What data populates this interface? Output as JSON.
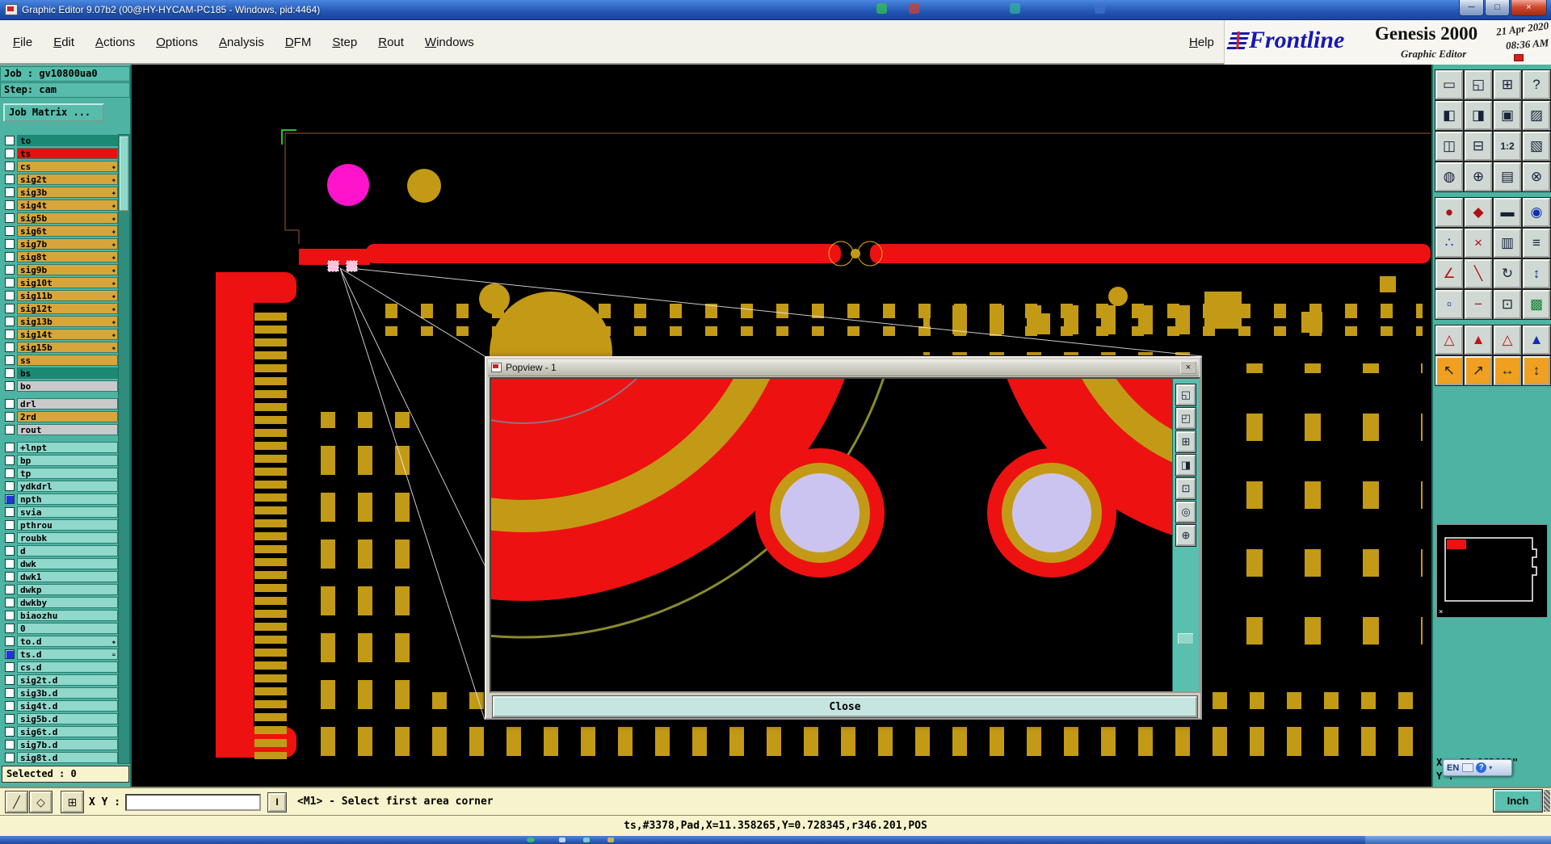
{
  "window": {
    "title": "Graphic Editor 9.07b2 (00@HY-HYCAM-PC185 - Windows, pid:4464)",
    "min_icon": "─",
    "max_icon": "□",
    "close_icon": "×"
  },
  "menubar": {
    "items": [
      "File",
      "Edit",
      "Actions",
      "Options",
      "Analysis",
      "DFM",
      "Step",
      "Rout",
      "Windows"
    ],
    "help": "Help"
  },
  "brand": {
    "logo": "Frontline",
    "product": "Genesis 2000",
    "subtitle": "Graphic Editor",
    "date": "21 Apr 2020",
    "time": "08:36 AM"
  },
  "job": {
    "job_line": "Job : gv10800ua0",
    "step_line": "Step: cam",
    "matrix_button": "Job Matrix ..."
  },
  "layers": {
    "colors": {
      "tan": "#d7a63b",
      "pale": "#90d8cb",
      "gray": "#c9c9c9",
      "dark": "#1b8a74",
      "red": "#e41212",
      "check_blue": "#2233dd"
    },
    "rows": [
      {
        "name": "to",
        "color": "#1b8a74",
        "check": "#ffffff",
        "mark": ""
      },
      {
        "name": "ts",
        "color": "#e41212",
        "check": "#ffffff",
        "mark": ""
      },
      {
        "name": "cs",
        "color": "#d7a63b",
        "check": "#ffffff",
        "mark": "◆"
      },
      {
        "name": "sig2t",
        "color": "#d7a63b",
        "check": "#ffffff",
        "mark": "◆"
      },
      {
        "name": "sig3b",
        "color": "#d7a63b",
        "check": "#ffffff",
        "mark": "◆"
      },
      {
        "name": "sig4t",
        "color": "#d7a63b",
        "check": "#ffffff",
        "mark": "◆"
      },
      {
        "name": "sig5b",
        "color": "#d7a63b",
        "check": "#ffffff",
        "mark": "◆"
      },
      {
        "name": "sig6t",
        "color": "#d7a63b",
        "check": "#ffffff",
        "mark": "◆"
      },
      {
        "name": "sig7b",
        "color": "#d7a63b",
        "check": "#ffffff",
        "mark": "◆"
      },
      {
        "name": "sig8t",
        "color": "#d7a63b",
        "check": "#ffffff",
        "mark": "◆"
      },
      {
        "name": "sig9b",
        "color": "#d7a63b",
        "check": "#ffffff",
        "mark": "◆"
      },
      {
        "name": "sig10t",
        "color": "#d7a63b",
        "check": "#ffffff",
        "mark": "◆"
      },
      {
        "name": "sig11b",
        "color": "#d7a63b",
        "check": "#ffffff",
        "mark": "◆"
      },
      {
        "name": "sig12t",
        "color": "#d7a63b",
        "check": "#ffffff",
        "mark": "◆"
      },
      {
        "name": "sig13b",
        "color": "#d7a63b",
        "check": "#ffffff",
        "mark": "◆"
      },
      {
        "name": "sig14t",
        "color": "#d7a63b",
        "check": "#ffffff",
        "mark": "◆"
      },
      {
        "name": "sig15b",
        "color": "#d7a63b",
        "check": "#ffffff",
        "mark": "◆"
      },
      {
        "name": "ss",
        "color": "#d7a63b",
        "check": "#ffffff",
        "mark": ""
      },
      {
        "name": "bs",
        "color": "#1b8a74",
        "check": "#ffffff",
        "mark": ""
      },
      {
        "name": "bo",
        "color": "#c9c9c9",
        "check": "#ffffff",
        "mark": ""
      },
      {
        "gap": true
      },
      {
        "name": "drl",
        "color": "#c9c9c9",
        "check": "#ffffff",
        "mark": ""
      },
      {
        "name": "2rd",
        "color": "#d7a63b",
        "check": "#ffffff",
        "mark": ""
      },
      {
        "name": "rout",
        "color": "#c9c9c9",
        "check": "#ffffff",
        "mark": ""
      },
      {
        "gap": true
      },
      {
        "name": "+lnpt",
        "color": "#90d8cb",
        "check": "#ffffff",
        "mark": ""
      },
      {
        "name": "bp",
        "color": "#90d8cb",
        "check": "#ffffff",
        "mark": ""
      },
      {
        "name": "tp",
        "color": "#90d8cb",
        "check": "#ffffff",
        "mark": ""
      },
      {
        "name": "ydkdrl",
        "color": "#90d8cb",
        "check": "#ffffff",
        "mark": ""
      },
      {
        "name": "npth",
        "color": "#90d8cb",
        "check": "#2233dd",
        "mark": ""
      },
      {
        "name": "svia",
        "color": "#90d8cb",
        "check": "#ffffff",
        "mark": ""
      },
      {
        "name": "pthrou",
        "color": "#90d8cb",
        "check": "#ffffff",
        "mark": ""
      },
      {
        "name": "roubk",
        "color": "#90d8cb",
        "check": "#ffffff",
        "mark": ""
      },
      {
        "name": "d",
        "color": "#90d8cb",
        "check": "#ffffff",
        "mark": ""
      },
      {
        "name": "dwk",
        "color": "#90d8cb",
        "check": "#ffffff",
        "mark": ""
      },
      {
        "name": "dwk1",
        "color": "#90d8cb",
        "check": "#ffffff",
        "mark": ""
      },
      {
        "name": "dwkp",
        "color": "#90d8cb",
        "check": "#ffffff",
        "mark": ""
      },
      {
        "name": "dwkby",
        "color": "#90d8cb",
        "check": "#ffffff",
        "mark": ""
      },
      {
        "name": "biaozhu",
        "color": "#90d8cb",
        "check": "#ffffff",
        "mark": ""
      },
      {
        "name": "0",
        "color": "#90d8cb",
        "check": "#ffffff",
        "mark": ""
      },
      {
        "name": "to.d",
        "color": "#90d8cb",
        "check": "#ffffff",
        "mark": "◆"
      },
      {
        "name": "ts.d",
        "color": "#90d8cb",
        "check": "#2233dd",
        "mark": "="
      },
      {
        "name": "cs.d",
        "color": "#90d8cb",
        "check": "#ffffff",
        "mark": ""
      },
      {
        "name": "sig2t.d",
        "color": "#90d8cb",
        "check": "#ffffff",
        "mark": ""
      },
      {
        "name": "sig3b.d",
        "color": "#90d8cb",
        "check": "#ffffff",
        "mark": ""
      },
      {
        "name": "sig4t.d",
        "color": "#90d8cb",
        "check": "#ffffff",
        "mark": ""
      },
      {
        "name": "sig5b.d",
        "color": "#90d8cb",
        "check": "#ffffff",
        "mark": ""
      },
      {
        "name": "sig6t.d",
        "color": "#90d8cb",
        "check": "#ffffff",
        "mark": ""
      },
      {
        "name": "sig7b.d",
        "color": "#90d8cb",
        "check": "#ffffff",
        "mark": ""
      },
      {
        "name": "sig8t.d",
        "color": "#90d8cb",
        "check": "#ffffff",
        "mark": ""
      }
    ]
  },
  "selected": {
    "label": "Selected : 0"
  },
  "status": {
    "xy_label": "X Y :",
    "xy_value": "",
    "tools": [
      {
        "g": "╱",
        "n": "line-mode-button"
      },
      {
        "g": "◇",
        "n": "shape-mode-button"
      },
      {
        "g": "⊞",
        "n": "grid-toggle-button"
      }
    ],
    "separator": "I",
    "prompt": "<M1> - Select first area corner",
    "readout": "ts,#3378,Pad,X=11.358265,Y=0.728345,r346.201,POS"
  },
  "right": {
    "x_label": "X :",
    "x_value": "22.862602\"",
    "y_label": "Y :",
    "y_value": "",
    "unit_button": "Inch",
    "lang": "EN",
    "help_icon": "?"
  },
  "popview": {
    "title": "Popview - 1",
    "x_icon": "×",
    "close_label": "Close",
    "tools": [
      {
        "g": "◱",
        "n": "popview-zoom-window-button"
      },
      {
        "g": "◰",
        "n": "popview-zoom-prev-button"
      },
      {
        "g": "⊞",
        "n": "popview-zoom-in-button"
      },
      {
        "g": "◨",
        "n": "popview-pan-button"
      },
      {
        "g": "⊡",
        "n": "popview-center-button"
      },
      {
        "g": "◎",
        "n": "popview-home-button"
      },
      {
        "g": "⊕",
        "n": "popview-crosshair-button"
      }
    ]
  },
  "toolbar": {
    "buttons": [
      {
        "g": "▭",
        "n": "zoom-window-button"
      },
      {
        "g": "◱",
        "n": "zoom-prev-button"
      },
      {
        "g": "⊞",
        "n": "zoom-in-button"
      },
      {
        "g": "?",
        "n": "help-tool-button"
      },
      {
        "g": "◧"
      },
      {
        "g": "◨"
      },
      {
        "g": "▣"
      },
      {
        "g": "▨"
      },
      {
        "g": "◫"
      },
      {
        "g": "⊟"
      },
      {
        "g": "1:2",
        "n": "scale-1to2-button"
      },
      {
        "g": "▧"
      },
      {
        "g": "◍"
      },
      {
        "g": "⊕"
      },
      {
        "g": "▤"
      },
      {
        "g": "⊗"
      },
      {
        "g": "●",
        "fg": "#b01010"
      },
      {
        "g": "◆",
        "fg": "#b01010"
      },
      {
        "g": "▬"
      },
      {
        "g": "◉",
        "fg": "#1030b0"
      },
      {
        "g": "∴",
        "fg": "#1030b0"
      },
      {
        "g": "×",
        "fg": "#b01010"
      },
      {
        "g": "▥"
      },
      {
        "g": "≡"
      },
      {
        "g": "∠",
        "fg": "#b01010"
      },
      {
        "g": "╲",
        "fg": "#b01010"
      },
      {
        "g": "↻"
      },
      {
        "g": "↕",
        "fg": "#1030b0"
      },
      {
        "g": "▫",
        "fg": "#1030b0"
      },
      {
        "g": "−",
        "fg": "#b01010"
      },
      {
        "g": "⊡"
      },
      {
        "g": "▩",
        "fg": "#108030"
      },
      {
        "g": "△",
        "fg": "#c41414"
      },
      {
        "g": "▲",
        "fg": "#c41414"
      },
      {
        "g": "△",
        "fg": "#c41414"
      },
      {
        "g": "▲",
        "fg": "#1030b0"
      },
      {
        "g": "↖",
        "bg": "#f0a020"
      },
      {
        "g": "↗",
        "bg": "#f0a020"
      },
      {
        "g": "↔",
        "bg": "#f0a020"
      },
      {
        "g": "↕",
        "bg": "#f0a020"
      }
    ]
  }
}
